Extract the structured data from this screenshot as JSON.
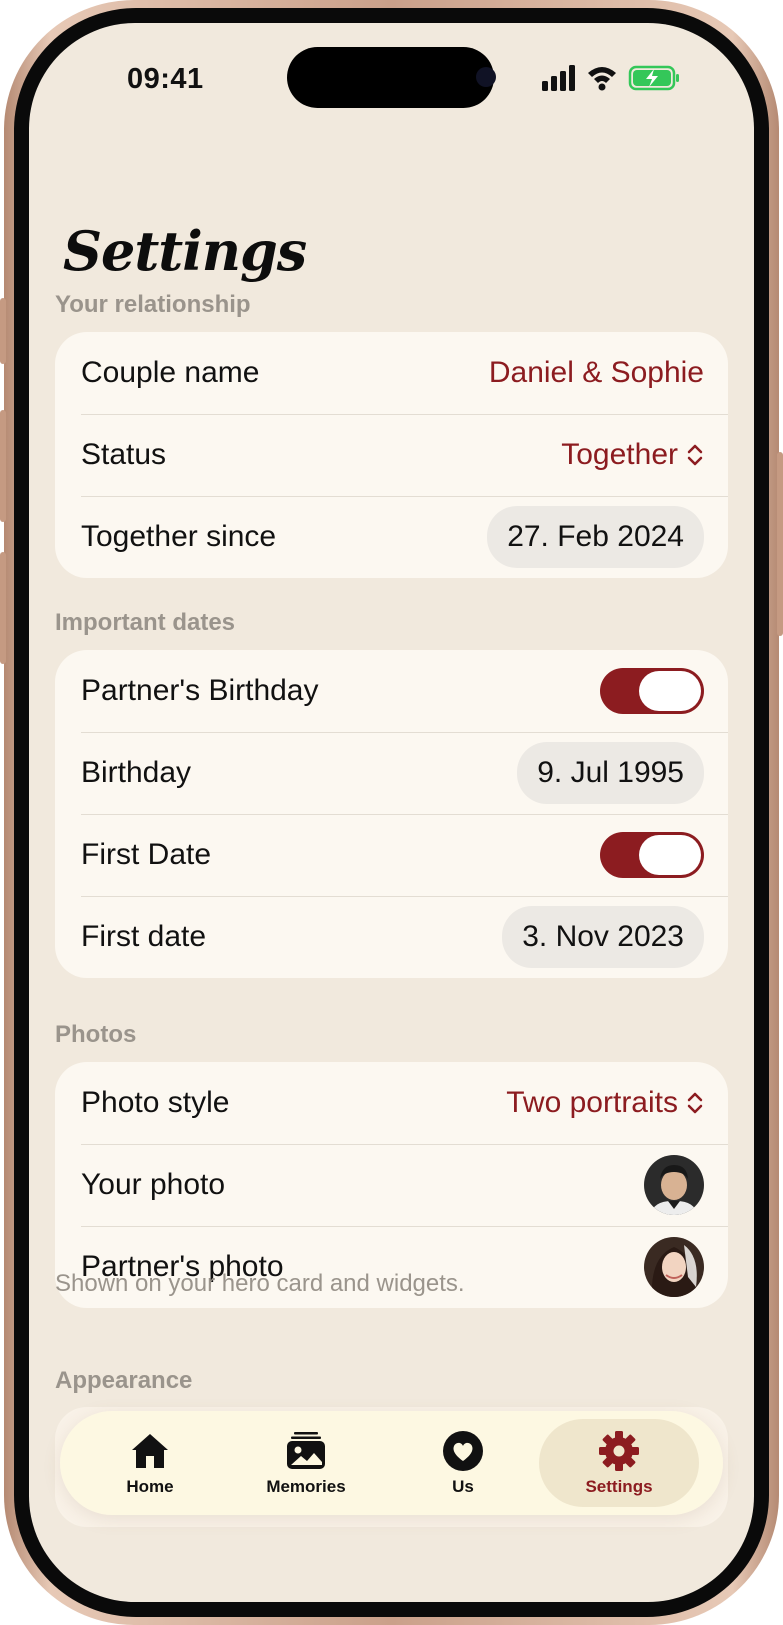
{
  "status_bar": {
    "time": "09:41"
  },
  "page": {
    "title": "Settings"
  },
  "relationship": {
    "header": "Your relationship",
    "couple_name_label": "Couple name",
    "couple_name_value": "Daniel & Sophie",
    "status_label": "Status",
    "status_value": "Together",
    "together_since_label": "Together since",
    "together_since_value": "27. Feb 2024"
  },
  "important_dates": {
    "header": "Important dates",
    "partner_birthday_label": "Partner's Birthday",
    "partner_birthday_enabled": true,
    "birthday_label": "Birthday",
    "birthday_value": "9. Jul 1995",
    "first_date_toggle_label": "First Date",
    "first_date_enabled": true,
    "first_date_label": "First date",
    "first_date_value": "3. Nov 2023"
  },
  "photos": {
    "header": "Photos",
    "photo_style_label": "Photo style",
    "photo_style_value": "Two portraits",
    "your_photo_label": "Your photo",
    "partner_photo_label": "Partner's photo",
    "note": "Shown on your hero card and widgets."
  },
  "appearance": {
    "header": "Appearance"
  },
  "tabbar": {
    "home": "Home",
    "memories": "Memories",
    "us": "Us",
    "settings": "Settings",
    "active": "settings"
  },
  "colors": {
    "accent": "#8c1c20",
    "background": "#f1e9dd",
    "card": "#fcf8f1",
    "battery": "#34c759"
  }
}
